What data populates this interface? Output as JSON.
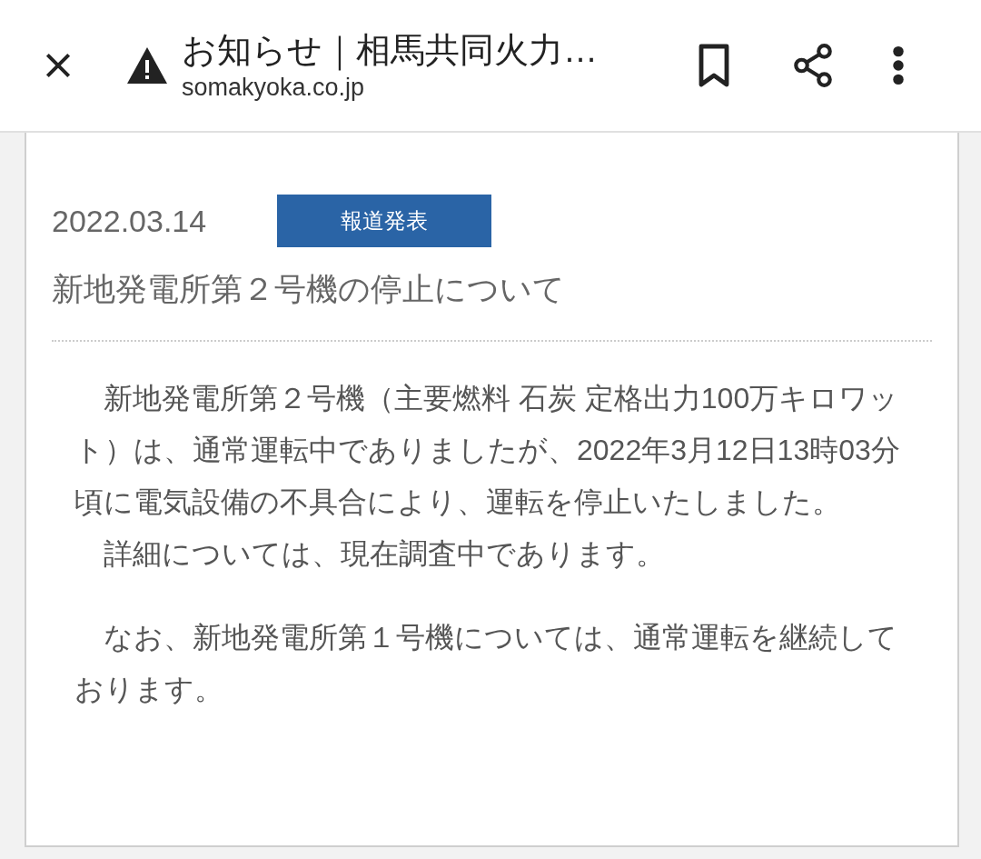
{
  "toolbar": {
    "title": "お知らせ｜相馬共同火力…",
    "url": "somakyoka.co.jp"
  },
  "article": {
    "date": "2022.03.14",
    "category": "報道発表",
    "title": "新地発電所第２号機の停止について",
    "blocks": [
      [
        "　新地発電所第２号機（主要燃料 石炭 定格出力100万キロワット）は、通常運転中でありましたが、2022年3月12日13時03分頃に電気設備の不具合により、運転を停止いたしました。",
        "　詳細については、現在調査中であります。"
      ],
      [
        "　なお、新地発電所第１号機については、通常運転を継続しております。"
      ]
    ]
  }
}
